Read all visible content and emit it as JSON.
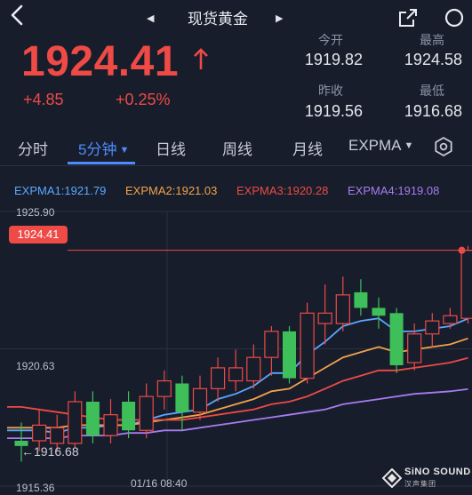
{
  "header": {
    "title": "现货黄金"
  },
  "quote": {
    "price": "1924.41",
    "change": "+4.85",
    "change_pct": "+0.25%",
    "stats": [
      {
        "label": "今开",
        "value": "1919.82"
      },
      {
        "label": "最高",
        "value": "1924.58"
      },
      {
        "label": "昨收",
        "value": "1919.56"
      },
      {
        "label": "最低",
        "value": "1916.68"
      }
    ]
  },
  "tabs": [
    {
      "label": "分时"
    },
    {
      "label": "5分钟",
      "active": true
    },
    {
      "label": "日线"
    },
    {
      "label": "周线"
    },
    {
      "label": "月线"
    },
    {
      "label": "EXPMA"
    }
  ],
  "legend": [
    {
      "text": "EXPMA1:1921.79",
      "color": "#5aa8ff"
    },
    {
      "text": "EXPMA2:1921.03",
      "color": "#f2a24a"
    },
    {
      "text": "EXPMA3:1920.28",
      "color": "#ee4a46"
    },
    {
      "text": "EXPMA4:1919.08",
      "color": "#a77cf0"
    }
  ],
  "axis": {
    "top": "1925.90",
    "mid": "1920.63",
    "bottom": "1915.36",
    "low_marker": "←1916.68",
    "time": "01/16 08:40",
    "current_price_tag": "1924.41"
  },
  "brand": {
    "name": "SiNO SOUND",
    "sub": "汉声集团"
  },
  "colors": {
    "up": "#ee4a46",
    "down": "#3fbf5a",
    "accent": "#4e8bff"
  },
  "chart_data": {
    "type": "candlestick",
    "ylim": [
      1915.36,
      1925.9
    ],
    "current": 1924.41,
    "candles": [
      {
        "o": 1916.9,
        "c": 1917.1,
        "h": 1917.8,
        "l": 1916.3,
        "d": "down"
      },
      {
        "o": 1917.1,
        "c": 1917.7,
        "h": 1918.3,
        "l": 1916.7,
        "d": "up"
      },
      {
        "o": 1917.6,
        "c": 1917.0,
        "h": 1918.1,
        "l": 1916.68,
        "d": "up"
      },
      {
        "o": 1917.0,
        "c": 1918.6,
        "h": 1919.0,
        "l": 1916.8,
        "d": "up"
      },
      {
        "o": 1918.6,
        "c": 1917.3,
        "h": 1919.0,
        "l": 1917.0,
        "d": "down"
      },
      {
        "o": 1917.3,
        "c": 1918.1,
        "h": 1918.7,
        "l": 1917.0,
        "d": "up"
      },
      {
        "o": 1918.6,
        "c": 1917.5,
        "h": 1919.0,
        "l": 1917.2,
        "d": "down"
      },
      {
        "o": 1917.5,
        "c": 1918.8,
        "h": 1919.3,
        "l": 1917.2,
        "d": "up"
      },
      {
        "o": 1918.8,
        "c": 1919.4,
        "h": 1919.8,
        "l": 1918.3,
        "d": "up"
      },
      {
        "o": 1919.3,
        "c": 1918.2,
        "h": 1919.6,
        "l": 1917.5,
        "d": "down"
      },
      {
        "o": 1918.2,
        "c": 1919.1,
        "h": 1919.6,
        "l": 1917.9,
        "d": "up"
      },
      {
        "o": 1919.1,
        "c": 1919.9,
        "h": 1920.3,
        "l": 1918.6,
        "d": "up"
      },
      {
        "o": 1919.9,
        "c": 1919.4,
        "h": 1920.6,
        "l": 1919.0,
        "d": "up"
      },
      {
        "o": 1919.4,
        "c": 1920.3,
        "h": 1920.8,
        "l": 1919.1,
        "d": "up"
      },
      {
        "o": 1920.3,
        "c": 1921.3,
        "h": 1921.5,
        "l": 1919.6,
        "d": "up"
      },
      {
        "o": 1921.3,
        "c": 1919.5,
        "h": 1921.5,
        "l": 1919.3,
        "d": "down"
      },
      {
        "o": 1919.5,
        "c": 1922.0,
        "h": 1922.4,
        "l": 1919.3,
        "d": "up"
      },
      {
        "o": 1922.0,
        "c": 1921.6,
        "h": 1923.1,
        "l": 1920.8,
        "d": "up"
      },
      {
        "o": 1921.6,
        "c": 1922.7,
        "h": 1923.4,
        "l": 1921.3,
        "d": "up"
      },
      {
        "o": 1922.8,
        "c": 1922.2,
        "h": 1923.3,
        "l": 1921.9,
        "d": "down"
      },
      {
        "o": 1922.2,
        "c": 1921.9,
        "h": 1922.6,
        "l": 1921.4,
        "d": "down"
      },
      {
        "o": 1922.0,
        "c": 1920.0,
        "h": 1922.2,
        "l": 1919.7,
        "d": "down"
      },
      {
        "o": 1920.1,
        "c": 1921.2,
        "h": 1921.6,
        "l": 1919.8,
        "d": "up"
      },
      {
        "o": 1921.2,
        "c": 1921.7,
        "h": 1922.0,
        "l": 1920.7,
        "d": "up"
      },
      {
        "o": 1921.6,
        "c": 1921.9,
        "h": 1922.2,
        "l": 1921.4,
        "d": "up"
      },
      {
        "o": 1921.8,
        "c": 1924.41,
        "h": 1924.58,
        "l": 1921.6,
        "d": "up"
      }
    ],
    "expma": [
      {
        "name": "EXPMA1",
        "color": "#5aa8ff",
        "values": [
          1917.5,
          1917.5,
          1917.4,
          1917.6,
          1917.6,
          1917.7,
          1917.7,
          1917.9,
          1918.1,
          1918.2,
          1918.3,
          1918.7,
          1918.9,
          1919.2,
          1919.7,
          1919.7,
          1920.4,
          1920.9,
          1921.5,
          1921.7,
          1921.8,
          1921.3,
          1921.3,
          1921.4,
          1921.5,
          1921.79
        ]
      },
      {
        "name": "EXPMA2",
        "color": "#f2a24a",
        "values": [
          1917.6,
          1917.6,
          1917.6,
          1917.7,
          1917.7,
          1917.7,
          1917.7,
          1917.8,
          1917.9,
          1918.0,
          1918.1,
          1918.3,
          1918.5,
          1918.7,
          1919.0,
          1919.1,
          1919.5,
          1919.9,
          1920.3,
          1920.5,
          1920.7,
          1920.5,
          1920.6,
          1920.7,
          1920.8,
          1921.03
        ]
      },
      {
        "name": "EXPMA3",
        "color": "#ee4a46",
        "values": [
          1918.4,
          1918.3,
          1918.2,
          1918.1,
          1918.0,
          1917.9,
          1917.9,
          1917.9,
          1917.9,
          1917.9,
          1918.0,
          1918.1,
          1918.2,
          1918.3,
          1918.5,
          1918.6,
          1918.8,
          1919.1,
          1919.4,
          1919.6,
          1919.8,
          1919.8,
          1919.9,
          1920.0,
          1920.1,
          1920.28
        ]
      },
      {
        "name": "EXPMA4",
        "color": "#a77cf0",
        "values": [
          1917.2,
          1917.2,
          1917.2,
          1917.3,
          1917.3,
          1917.3,
          1917.4,
          1917.4,
          1917.5,
          1917.5,
          1917.6,
          1917.7,
          1917.8,
          1917.9,
          1918.0,
          1918.1,
          1918.2,
          1918.3,
          1918.5,
          1918.6,
          1918.7,
          1918.8,
          1918.9,
          1918.95,
          1919.0,
          1919.08
        ]
      }
    ]
  }
}
